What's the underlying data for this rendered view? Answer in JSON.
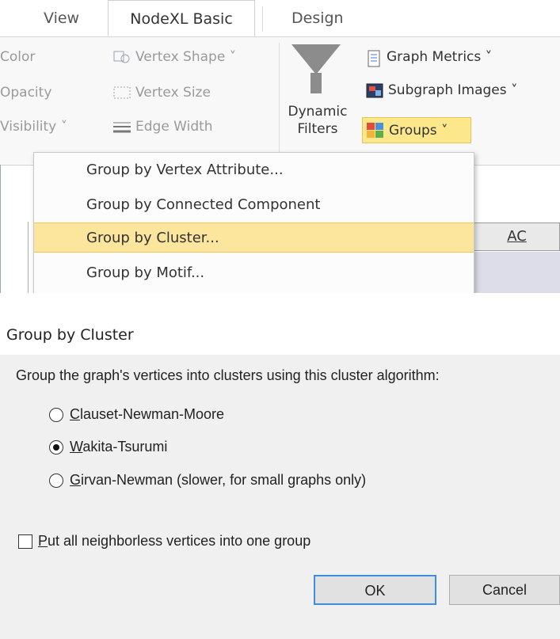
{
  "ribbon": {
    "tabs": [
      "View",
      "NodeXL Basic",
      "Design"
    ],
    "left_items": [
      {
        "label": "Color",
        "icon": "none"
      },
      {
        "label": "Opacity",
        "icon": "none"
      },
      {
        "label": "Visibility ˅",
        "icon": "none"
      },
      {
        "label": "Vertex Shape ˅",
        "icon": "vertex-shape-icon"
      },
      {
        "label": "Vertex Size",
        "icon": "vertex-size-icon"
      },
      {
        "label": "Edge Width",
        "icon": "edge-width-icon"
      }
    ],
    "dynamic_filters": [
      "Dynamic",
      "Filters"
    ],
    "graph_metrics": "Graph Metrics ˅",
    "subgraph_images": "Subgraph Images ˅",
    "groups": "Groups ˅",
    "column_header": "AC",
    "menu": [
      "Group by Vertex Attribute...",
      "Group by Connected Component",
      "Group by Cluster...",
      "Group by Motif..."
    ],
    "highlighted_index": 2,
    "accent": "#fce59c"
  },
  "dialog": {
    "title": "Group by Cluster",
    "prompt": "Group the graph's vertices into clusters using this cluster algorithm:",
    "options": [
      {
        "first": "C",
        "rest": "lauset-Newman-Moore",
        "selected": false
      },
      {
        "first": "W",
        "rest": "akita-Tsurumi",
        "selected": true
      },
      {
        "first": "G",
        "rest": "irvan-Newman (slower, for small graphs only)",
        "selected": false
      }
    ],
    "checkbox": {
      "first": "P",
      "rest": "ut all neighborless vertices into one group",
      "checked": false
    },
    "ok": "OK",
    "cancel": "Cancel"
  }
}
